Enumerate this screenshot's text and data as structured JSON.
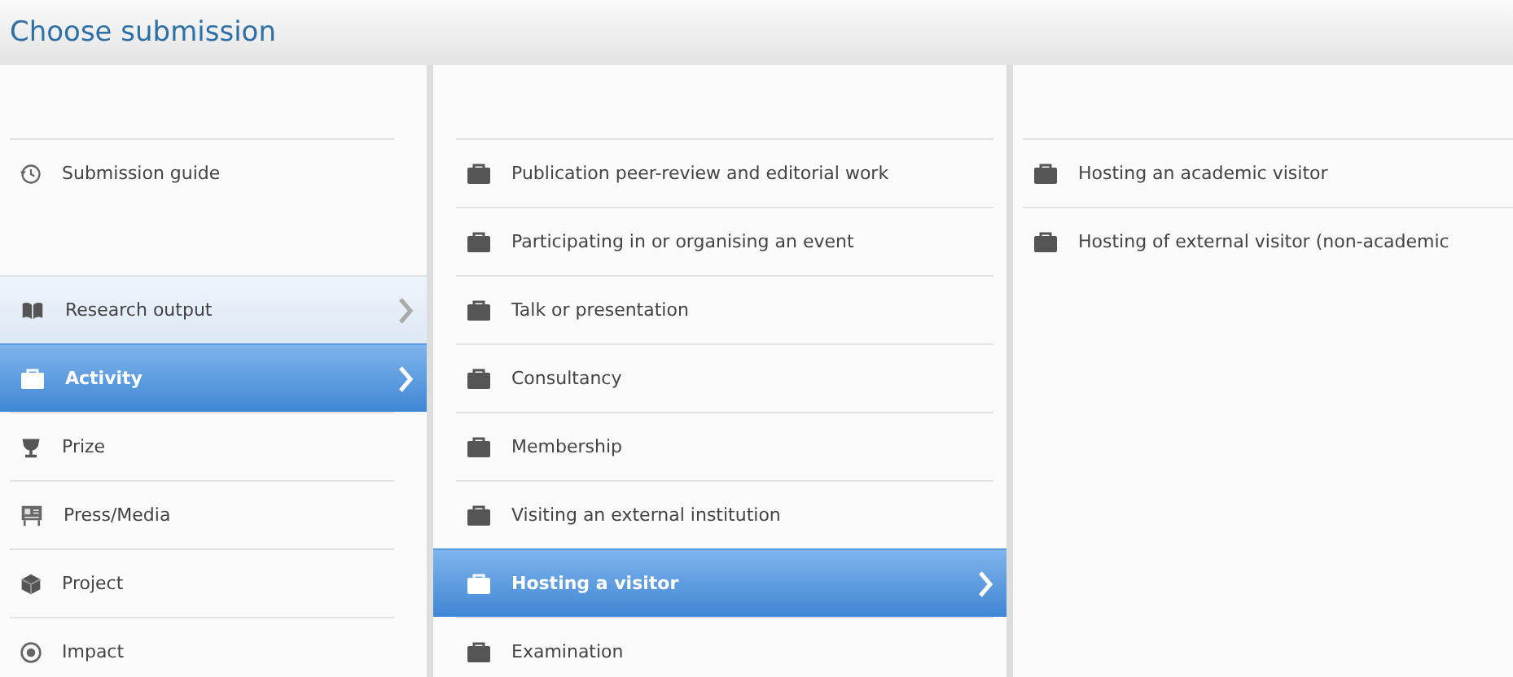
{
  "title": "Choose submission",
  "guide": {
    "label": "Submission guide"
  },
  "categories": [
    {
      "label": "Research output",
      "selected": false,
      "hovered": true
    },
    {
      "label": "Activity",
      "selected": true,
      "hovered": false
    },
    {
      "label": "Prize",
      "selected": false,
      "hovered": false
    },
    {
      "label": "Press/Media",
      "selected": false,
      "hovered": false
    },
    {
      "label": "Project",
      "selected": false,
      "hovered": false
    },
    {
      "label": "Impact",
      "selected": false,
      "hovered": false
    }
  ],
  "activity_types": [
    {
      "label": "Publication peer-review and editorial work",
      "selected": false
    },
    {
      "label": "Participating in or organising an event",
      "selected": false
    },
    {
      "label": "Talk or presentation",
      "selected": false
    },
    {
      "label": "Consultancy",
      "selected": false
    },
    {
      "label": "Membership",
      "selected": false
    },
    {
      "label": "Visiting an external institution",
      "selected": false
    },
    {
      "label": "Hosting a visitor",
      "selected": true
    },
    {
      "label": "Examination",
      "selected": false
    }
  ],
  "visitor_types": [
    {
      "label": "Hosting an academic visitor"
    },
    {
      "label": "Hosting of external visitor (non-academic"
    }
  ]
}
